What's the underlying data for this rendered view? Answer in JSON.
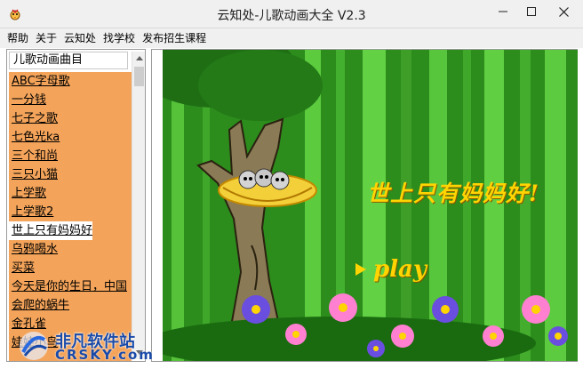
{
  "window": {
    "title": "云知处-儿歌动画大全 V2.3"
  },
  "menu": [
    {
      "label": "帮助"
    },
    {
      "label": "关于"
    },
    {
      "label": "云知处"
    },
    {
      "label": "找学校"
    },
    {
      "label": "发布招生课程"
    }
  ],
  "sidebar": {
    "header": "儿歌动画曲目",
    "songs": [
      {
        "label": "ABC字母歌"
      },
      {
        "label": "一分钱"
      },
      {
        "label": "七子之歌"
      },
      {
        "label": "七色光ka"
      },
      {
        "label": "三个和尚"
      },
      {
        "label": "三只小猫"
      },
      {
        "label": "上学歌"
      },
      {
        "label": "上学歌2"
      },
      {
        "label": "世上只有妈妈好"
      },
      {
        "label": "乌鸦喝水"
      },
      {
        "label": "买菜"
      },
      {
        "label": "今天是你的生日，中国"
      },
      {
        "label": "会爬的蜗牛"
      },
      {
        "label": "金孔雀"
      },
      {
        "label": "娃娃小鸟"
      }
    ],
    "selected_index": 8
  },
  "stage": {
    "song_title": "世上只有妈妈好!",
    "play_label": "play"
  },
  "watermark": {
    "line1": "非凡软件站",
    "line2": "CRSKY.com"
  },
  "colors": {
    "list_bg": "#f4a45a",
    "title_text": "#ffd400",
    "watermark": "#1a4aa8"
  },
  "icons": {
    "app": "cartoon-bird-icon",
    "minimize": "minimize-icon",
    "maximize": "maximize-icon",
    "close": "close-icon"
  }
}
